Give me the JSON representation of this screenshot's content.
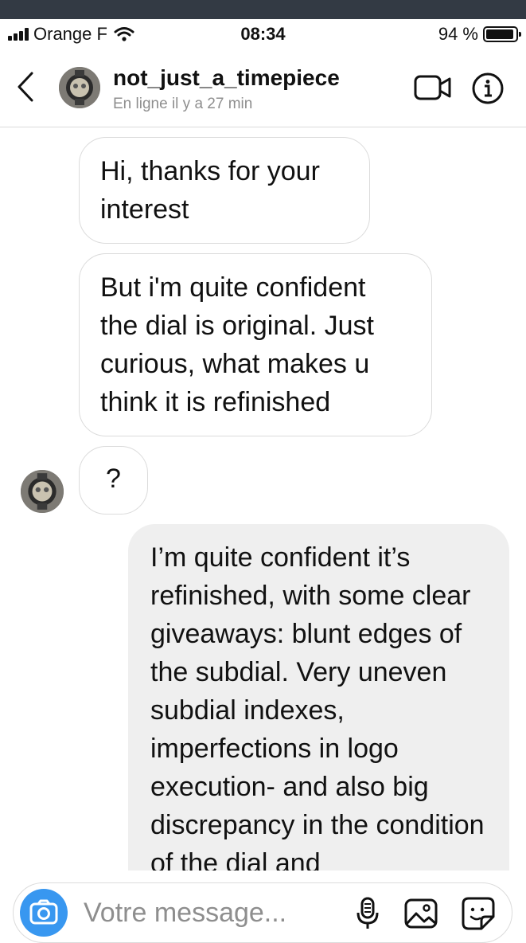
{
  "status": {
    "carrier": "Orange F",
    "time": "08:34",
    "battery_text": "94 %",
    "battery_level": 0.94
  },
  "header": {
    "username": "not_just_a_timepiece",
    "presence": "En ligne il y a 27 min",
    "icons": [
      "back-chevron-icon",
      "watch-avatar",
      "video-call-icon",
      "info-icon"
    ]
  },
  "messages": [
    {
      "sender": "them",
      "text": "Hi, thanks for your interest"
    },
    {
      "sender": "them",
      "text": "But i'm quite confident the dial is original. Just curious, what makes u think it is refinished"
    },
    {
      "sender": "them",
      "text": "?"
    },
    {
      "sender": "me",
      "text": "I’m quite confident it’s refinished, with some clear giveaways: blunt edges of the subdial. Very uneven subdial indexes, imperfections in logo execution- and also big discrepancy in the condition of the dial and"
    }
  ],
  "composer": {
    "placeholder": "Votre message...",
    "icons": [
      "camera-icon",
      "microphone-icon",
      "gallery-icon",
      "sticker-icon"
    ]
  },
  "colors": {
    "accent": "#3897f0",
    "incoming_border": "#dbdbdb",
    "outgoing_bg": "#efefef",
    "muted_text": "#8e8e8e"
  }
}
